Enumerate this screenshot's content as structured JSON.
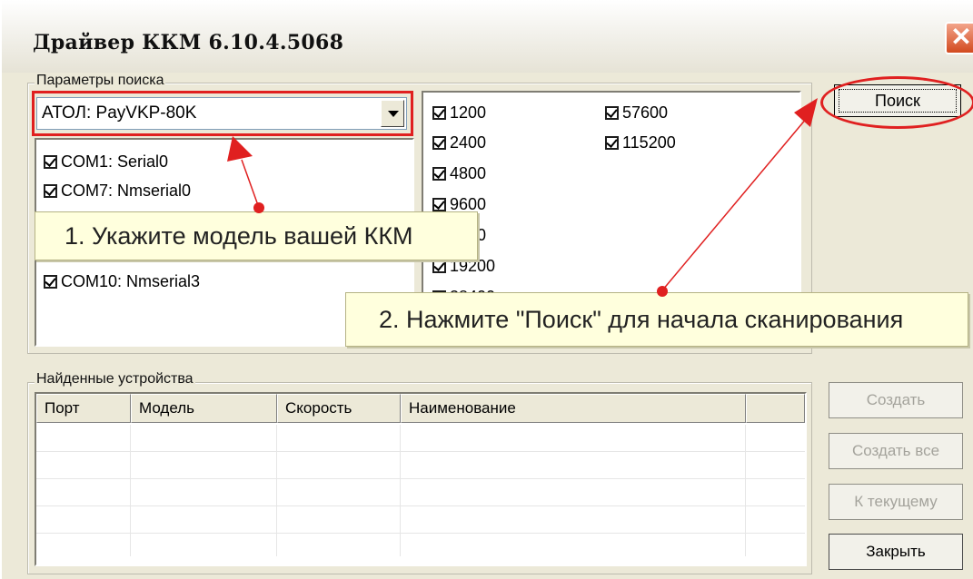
{
  "window": {
    "title": "Драйвер ККМ 6.10.4.5068",
    "close_icon": "close-icon"
  },
  "search_params": {
    "legend": "Параметры поиска",
    "model_value": "АТОЛ: PayVKP-80K",
    "ports": [
      "COM1: Serial0",
      "COM7: Nmserial0",
      "COM10: Nmserial3"
    ],
    "speeds_col1": [
      "1200",
      "2400",
      "4800",
      "9600",
      "4400",
      "19200"
    ],
    "speeds_col2": [
      "57600",
      "115200"
    ],
    "speed_partial": "38400"
  },
  "buttons": {
    "search": "Поиск",
    "create": "Создать",
    "create_all": "Создать все",
    "to_current": "К текущему",
    "close": "Закрыть"
  },
  "found_devices": {
    "legend": "Найденные устройства",
    "columns": [
      "Порт",
      "Модель",
      "Скорость",
      "Наименование",
      ""
    ]
  },
  "callouts": {
    "step1": "1. Укажите модель вашей ККМ",
    "step2": "2. Нажмите \"Поиск\" для начала сканирования"
  },
  "colors": {
    "annotation_red": "#e02020",
    "tooltip_bg": "#ffffdd",
    "window_bg": "#ece9d8"
  }
}
